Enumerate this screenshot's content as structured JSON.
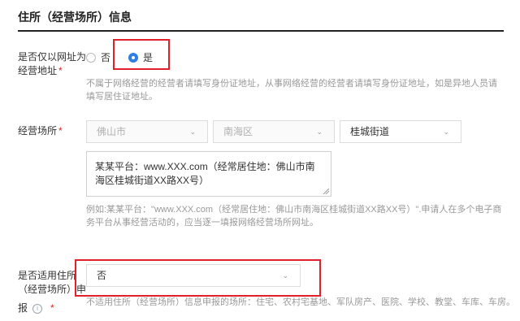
{
  "section": {
    "title": "住所（经营场所）信息"
  },
  "online_address": {
    "label_line1": "是否仅以网址为",
    "label_line2": "经营地址",
    "required": "*",
    "options": [
      {
        "label": "否",
        "checked": false
      },
      {
        "label": "是",
        "checked": true
      }
    ],
    "hint": "不属于网络经营的经营者请填写身份证地址，从事网络经营的经营者请填写身份证地址，如是异地人员请填写居住证地址。"
  },
  "premises": {
    "label": "经营场所",
    "required": "*",
    "city": "佛山市",
    "district": "南海区",
    "street": "桂城街道",
    "address": "某某平台：www.XXX.com（经常居住地：佛山市南海区桂城街道XX路XX号）",
    "hint": "例如:某某平台：\"www.XXX.com（经常居住地：佛山市南海区桂城街道XX路XX号）\".申请人在多个电子商务平台从事经营活动的，应当逐一填报网络经营场所网址。"
  },
  "applicable": {
    "label_line1": "是否适用住所",
    "label_line2": "（经营场所）申",
    "label_line3": "报",
    "required": "*",
    "value": "否",
    "hint": "不适用住所（经营场所）信息申报的场所：住宅、农村宅基地、军队房产、医院、学校、教堂、车库、车房。"
  },
  "colors": {
    "accent": "#2d7fe3",
    "required": "#e02020",
    "highlight": "#e0202a"
  }
}
